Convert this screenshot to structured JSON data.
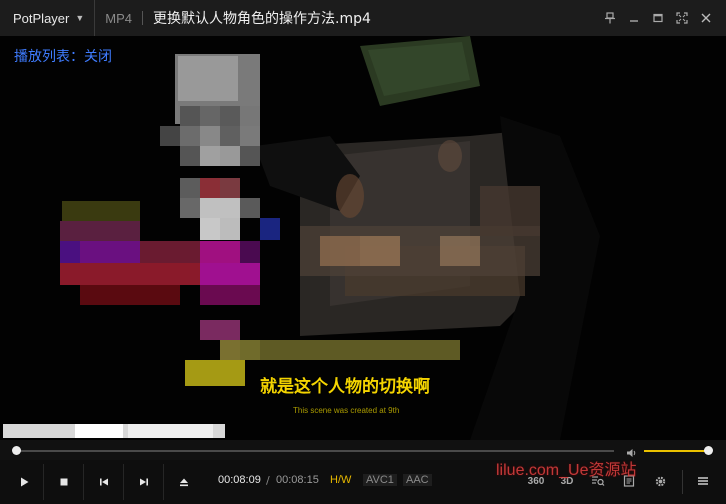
{
  "app": {
    "menu_label": "PotPlayer",
    "format": "MP4",
    "title": "更换默认人物角色的操作方法.mp4"
  },
  "overlay": {
    "playlist_label": "播放列表：关闭",
    "subtitle": "就是这个人物的切换啊",
    "credit_text": "This scene was created at 9th"
  },
  "playback": {
    "current_time": "00:08:09",
    "separator": "/",
    "total_time": "00:08:15",
    "progress": 0.0,
    "volume": 1.0
  },
  "badges": {
    "hw": "H/W",
    "video_codec": "AVC1",
    "audio_codec": "AAC"
  },
  "right_controls": {
    "deg360": "360",
    "stereo3d": "3D"
  },
  "watermark": "lilue.com_Ue资源站",
  "colors": {
    "accent": "#ecc200",
    "playlist_text": "#3f7cff",
    "subtitle": "#f4d400",
    "watermark": "#e04040"
  },
  "icons": [
    "chevron-down-icon",
    "pin-icon",
    "minimize-icon",
    "maximize-icon",
    "fullscreen-icon",
    "close-icon",
    "volume-icon",
    "play-icon",
    "stop-icon",
    "previous-icon",
    "next-icon",
    "eject-icon",
    "search-list-icon",
    "playlist-icon",
    "settings-icon",
    "menu-icon"
  ]
}
